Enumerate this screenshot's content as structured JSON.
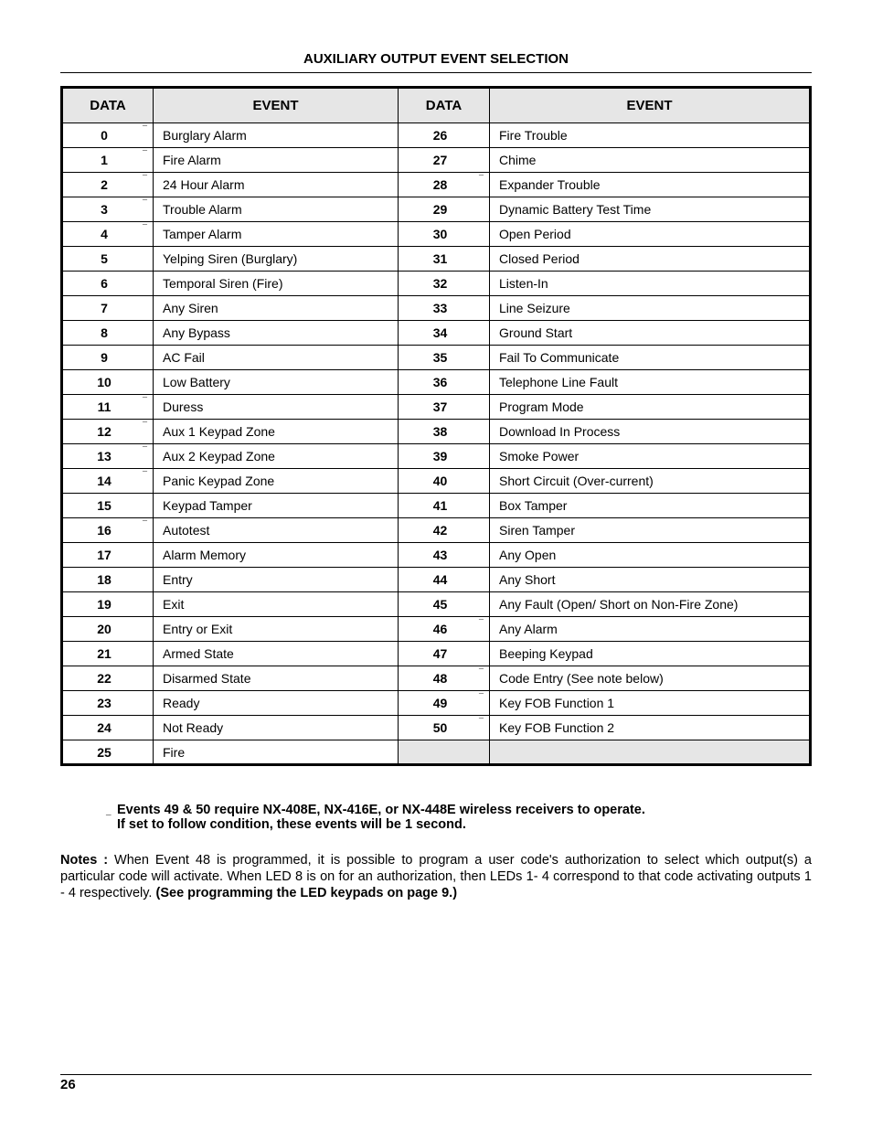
{
  "title": "AUXILIARY OUTPUT EVENT SELECTION",
  "headers": {
    "data": "DATA",
    "event": "EVENT"
  },
  "rows": [
    {
      "d1": "0",
      "m1": true,
      "e1": "Burglary Alarm",
      "d2": "26",
      "m2": false,
      "e2": "Fire Trouble"
    },
    {
      "d1": "1",
      "m1": true,
      "e1": "Fire Alarm",
      "d2": "27",
      "m2": false,
      "e2": "Chime"
    },
    {
      "d1": "2",
      "m1": true,
      "e1": "24 Hour Alarm",
      "d2": "28",
      "m2": true,
      "e2": "Expander Trouble"
    },
    {
      "d1": "3",
      "m1": true,
      "e1": "Trouble Alarm",
      "d2": "29",
      "m2": false,
      "e2": "Dynamic Battery Test Time"
    },
    {
      "d1": "4",
      "m1": true,
      "e1": "Tamper Alarm",
      "d2": "30",
      "m2": false,
      "e2": "Open Period"
    },
    {
      "d1": "5",
      "m1": false,
      "e1": "Yelping Siren (Burglary)",
      "d2": "31",
      "m2": false,
      "e2": "Closed Period"
    },
    {
      "d1": "6",
      "m1": false,
      "e1": "Temporal Siren (Fire)",
      "d2": "32",
      "m2": false,
      "e2": "Listen-In"
    },
    {
      "d1": "7",
      "m1": false,
      "e1": "Any Siren",
      "d2": "33",
      "m2": false,
      "e2": "Line Seizure"
    },
    {
      "d1": "8",
      "m1": false,
      "e1": "Any Bypass",
      "d2": "34",
      "m2": false,
      "e2": "Ground Start"
    },
    {
      "d1": "9",
      "m1": false,
      "e1": "AC Fail",
      "d2": "35",
      "m2": false,
      "e2": "Fail To Communicate"
    },
    {
      "d1": "10",
      "m1": false,
      "e1": "Low Battery",
      "d2": "36",
      "m2": false,
      "e2": "Telephone Line Fault"
    },
    {
      "d1": "11",
      "m1": true,
      "e1": "Duress",
      "d2": "37",
      "m2": false,
      "e2": "Program Mode"
    },
    {
      "d1": "12",
      "m1": true,
      "e1": "Aux 1 Keypad Zone",
      "d2": "38",
      "m2": false,
      "e2": "Download In Process"
    },
    {
      "d1": "13",
      "m1": true,
      "e1": "Aux 2 Keypad Zone",
      "d2": "39",
      "m2": false,
      "e2": "Smoke Power"
    },
    {
      "d1": "14",
      "m1": true,
      "e1": "Panic Keypad Zone",
      "d2": "40",
      "m2": false,
      "e2": "Short Circuit (Over-current)"
    },
    {
      "d1": "15",
      "m1": false,
      "e1": "Keypad Tamper",
      "d2": "41",
      "m2": false,
      "e2": "Box Tamper"
    },
    {
      "d1": "16",
      "m1": true,
      "e1": "Autotest",
      "d2": "42",
      "m2": false,
      "e2": "Siren Tamper"
    },
    {
      "d1": "17",
      "m1": false,
      "e1": "Alarm Memory",
      "d2": "43",
      "m2": false,
      "e2": "Any Open"
    },
    {
      "d1": "18",
      "m1": false,
      "e1": "Entry",
      "d2": "44",
      "m2": false,
      "e2": "Any Short"
    },
    {
      "d1": "19",
      "m1": false,
      "e1": "Exit",
      "d2": "45",
      "m2": false,
      "e2": "Any Fault (Open/ Short on Non-Fire Zone)"
    },
    {
      "d1": "20",
      "m1": false,
      "e1": "Entry or Exit",
      "d2": "46",
      "m2": true,
      "e2": "Any Alarm"
    },
    {
      "d1": "21",
      "m1": false,
      "e1": "Armed State",
      "d2": "47",
      "m2": false,
      "e2": "Beeping Keypad"
    },
    {
      "d1": "22",
      "m1": false,
      "e1": "Disarmed State",
      "d2": "48",
      "m2": true,
      "e2": "Code Entry (See note below)"
    },
    {
      "d1": "23",
      "m1": false,
      "e1": "Ready",
      "d2": "49",
      "m2": true,
      "e2": "Key FOB Function 1"
    },
    {
      "d1": "24",
      "m1": false,
      "e1": "Not Ready",
      "d2": "50",
      "m2": true,
      "e2": "Key FOB Function 2"
    },
    {
      "d1": "25",
      "m1": false,
      "e1": "Fire",
      "d2": "",
      "m2": false,
      "e2": "",
      "empty": true
    }
  ],
  "footnote_line1": "Events 49 & 50 require NX-408E, NX-416E, or NX-448E wireless receivers to operate.",
  "footnote_line2": "If set to follow condition, these events will be 1 second.",
  "notes_label": "Notes :",
  "notes_body": "  When Event 48 is programmed, it is possible to program a user code's authorization to select which output(s) a particular code will activate.  When LED 8 is on for an authorization, then LEDs 1- 4 correspond to that code activating outputs 1 - 4 respectively.  ",
  "notes_strong": "(See programming the LED keypads on page 9.)",
  "page_number": "26"
}
